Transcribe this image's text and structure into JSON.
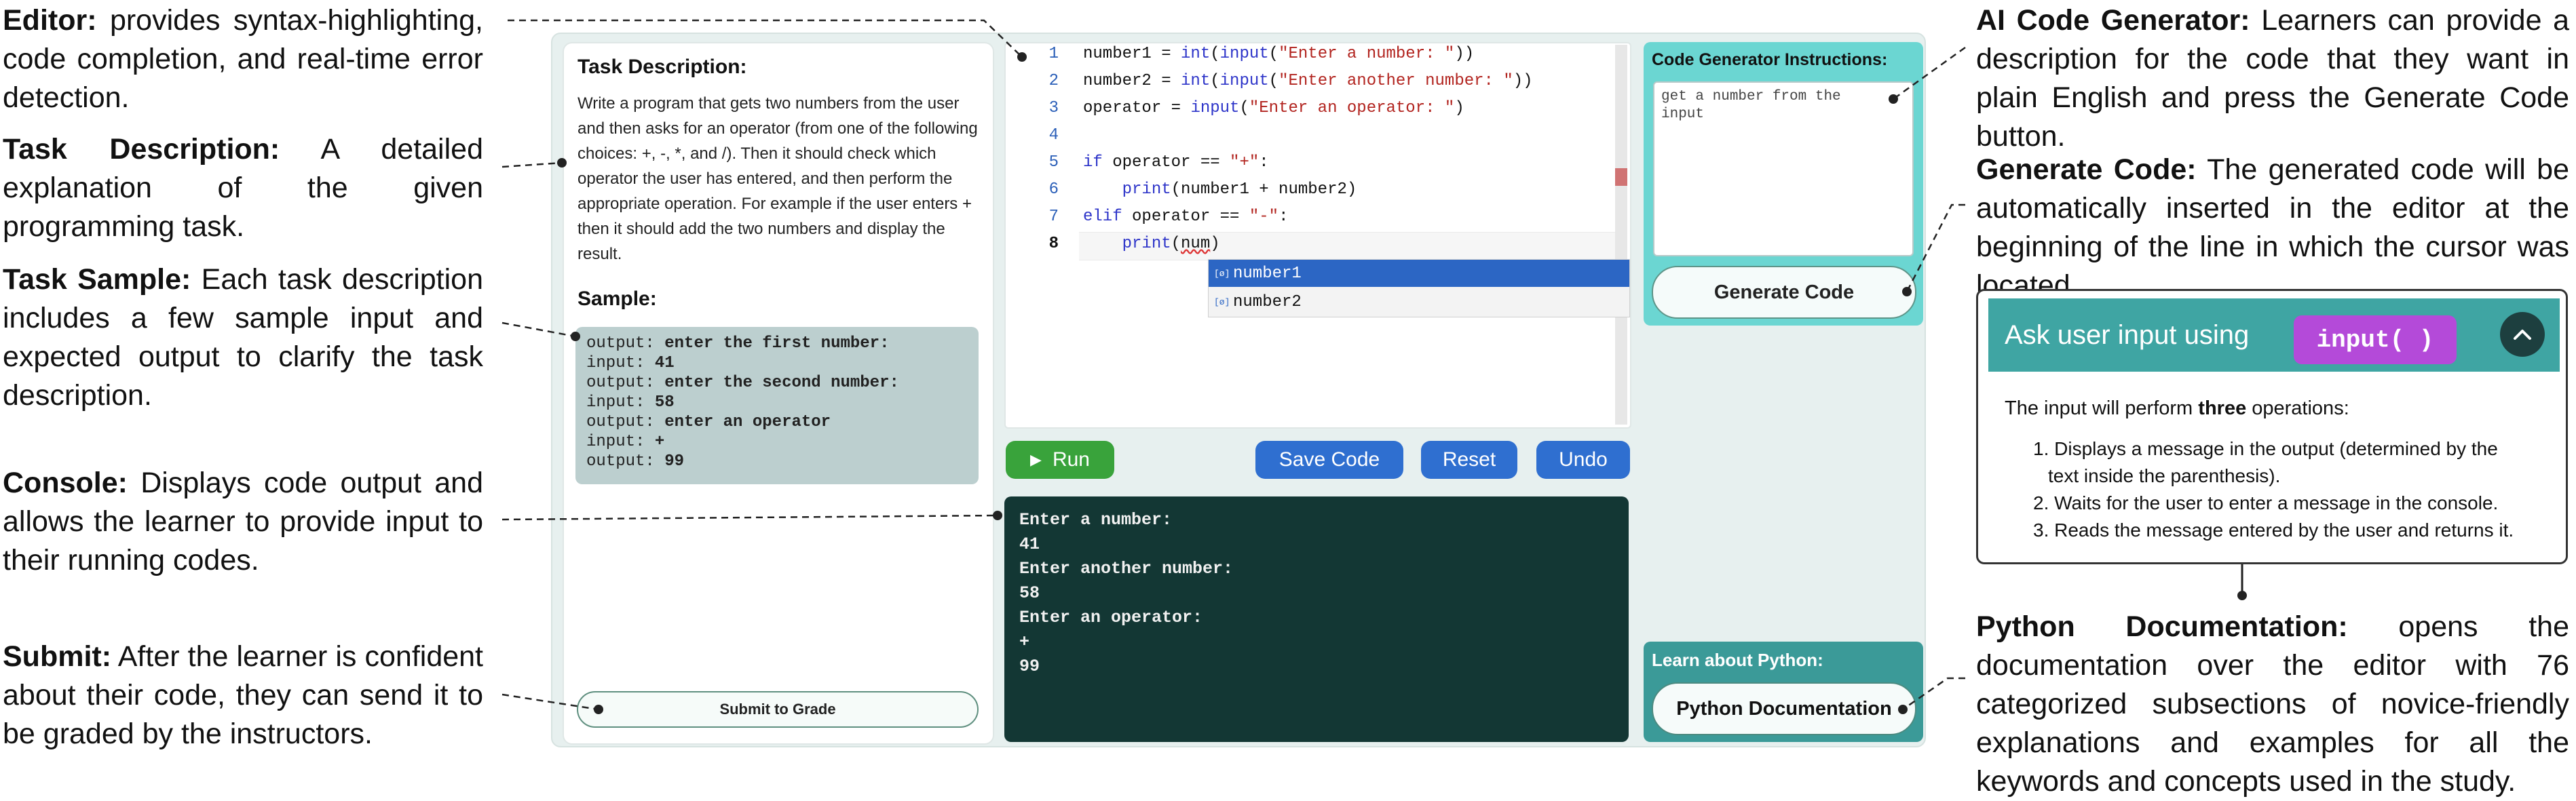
{
  "annotations": {
    "editor": {
      "title": "Editor:",
      "text": "provides syntax-highlighting, code completion, and real-time error detection."
    },
    "task_description": {
      "title": "Task Description:",
      "text": "A detailed explanation of the given programming task."
    },
    "task_sample": {
      "title": "Task Sample:",
      "text": "Each task description includes a few sample input and expected output to clarify the task description."
    },
    "console": {
      "title": "Console:",
      "text": "Displays code output and allows the learner to provide input to their running codes."
    },
    "submit": {
      "title": "Submit:",
      "text": "After the learner is confident about their code, they can send it to be graded by the instructors."
    },
    "ai_code_generator": {
      "title": "AI Code Generator:",
      "text": "Learners can provide a description for the code that they want in plain English and press the Generate Code button."
    },
    "generate_code": {
      "title": "Generate Code:",
      "text": "The generated code will be automatically inserted in the editor at the beginning of the line in which the cursor was located."
    },
    "python_documentation": {
      "title": "Python Documentation:",
      "text": "opens the documentation over the editor with 76 categorized subsections of novice-friendly explanations and examples for all the keywords and concepts used in the study."
    }
  },
  "task": {
    "heading": "Task Description:",
    "text": "Write a program that gets two numbers from the user and then asks for an operator (from one of the following choices: +, -, *, and /). Then it should check which operator the user has entered, and then perform the appropriate operation. For example if the user enters + then it should add the two numbers and display the result.",
    "sample_heading": "Sample:",
    "sample": [
      {
        "label": "output:",
        "value": "enter the first number:"
      },
      {
        "label": "input:",
        "value": "41"
      },
      {
        "label": "output:",
        "value": "enter the second number:"
      },
      {
        "label": "input:",
        "value": "58"
      },
      {
        "label": "output:",
        "value": "enter an operator"
      },
      {
        "label": "input:",
        "value": "+"
      },
      {
        "label": "output:",
        "value": "99"
      }
    ],
    "submit_label": "Submit to Grade"
  },
  "editor": {
    "line_numbers": [
      "1",
      "2",
      "3",
      "4",
      "5",
      "6",
      "7",
      "8"
    ],
    "autocomplete": [
      "number1",
      "number2"
    ],
    "autocomplete_icon": "[ø]"
  },
  "toolbar": {
    "run_label": "Run",
    "run_icon": "▶",
    "save_label": "Save Code",
    "reset_label": "Reset",
    "undo_label": "Undo"
  },
  "console": {
    "lines": [
      "Enter a number:",
      "41",
      "Enter another number:",
      "58",
      "Enter an operator:",
      "+",
      "99"
    ]
  },
  "generator": {
    "title": "Code Generator Instructions:",
    "prompt_text": "get a number from the input",
    "button_label": "Generate Code"
  },
  "learn": {
    "title": "Learn about Python:",
    "button_label": "Python Documentation"
  },
  "doc_card": {
    "header": "Ask user input using",
    "chip": "input( )",
    "intro_prefix": "The input will perform ",
    "intro_bold": "three",
    "intro_suffix": " operations:",
    "items": [
      "1. Displays a message in the output (determined by the",
      "text inside the parenthesis).",
      "2. Waits for the user to enter a message in the console.",
      "3. Reads the message entered by the user and returns it."
    ]
  },
  "colors": {
    "run": "#39a33b",
    "action": "#2f6fd0",
    "console_bg": "#133734",
    "generator_panel": "#6bd6d2",
    "learn_panel": "#3b9a98",
    "chip": "#b44ad9",
    "doc_header": "#3fa5a3"
  }
}
